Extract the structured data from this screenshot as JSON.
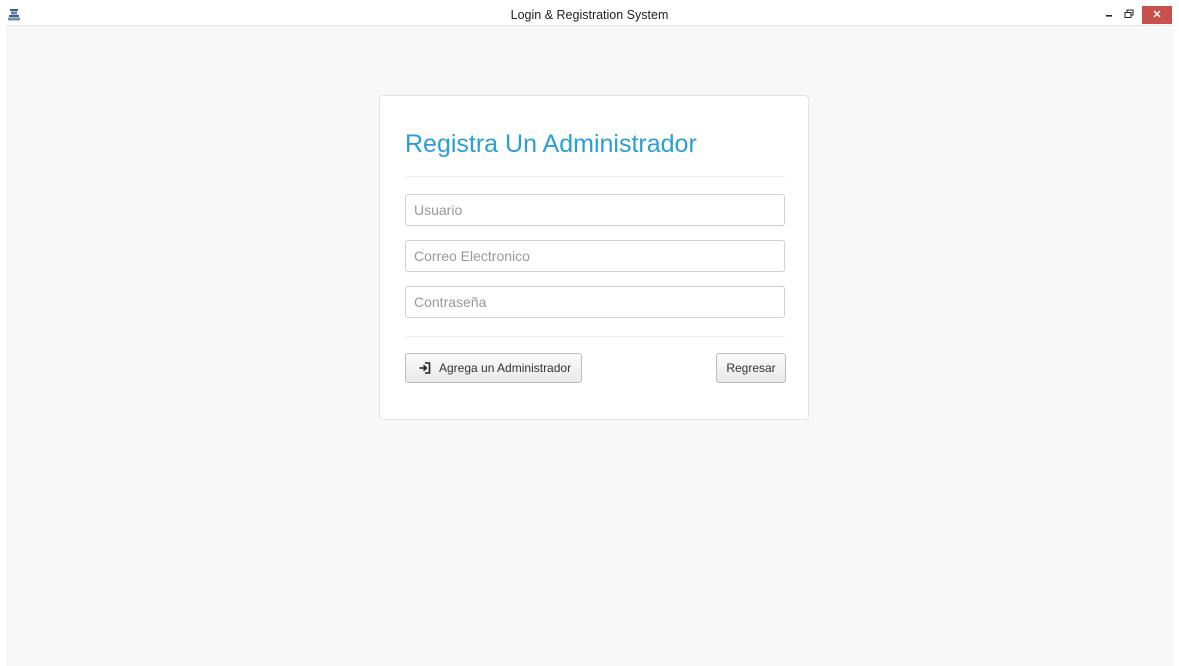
{
  "window": {
    "title": "Login & Registration System",
    "controls": {
      "minimize": "minimize",
      "maximize": "maximize",
      "close": "close"
    }
  },
  "form": {
    "heading": "Registra Un Administrador",
    "fields": {
      "username": {
        "placeholder": "Usuario",
        "value": ""
      },
      "email": {
        "placeholder": "Correo Electronico",
        "value": ""
      },
      "password": {
        "placeholder": "Contraseña",
        "value": ""
      }
    },
    "buttons": {
      "add_admin": {
        "label": "Agrega un Administrador",
        "icon": "sign-in-icon"
      },
      "back": {
        "label": "Regresar"
      }
    }
  },
  "colors": {
    "accent": "#2a9fd6",
    "close_button": "#c7504c",
    "background": "#f8f8f8"
  }
}
